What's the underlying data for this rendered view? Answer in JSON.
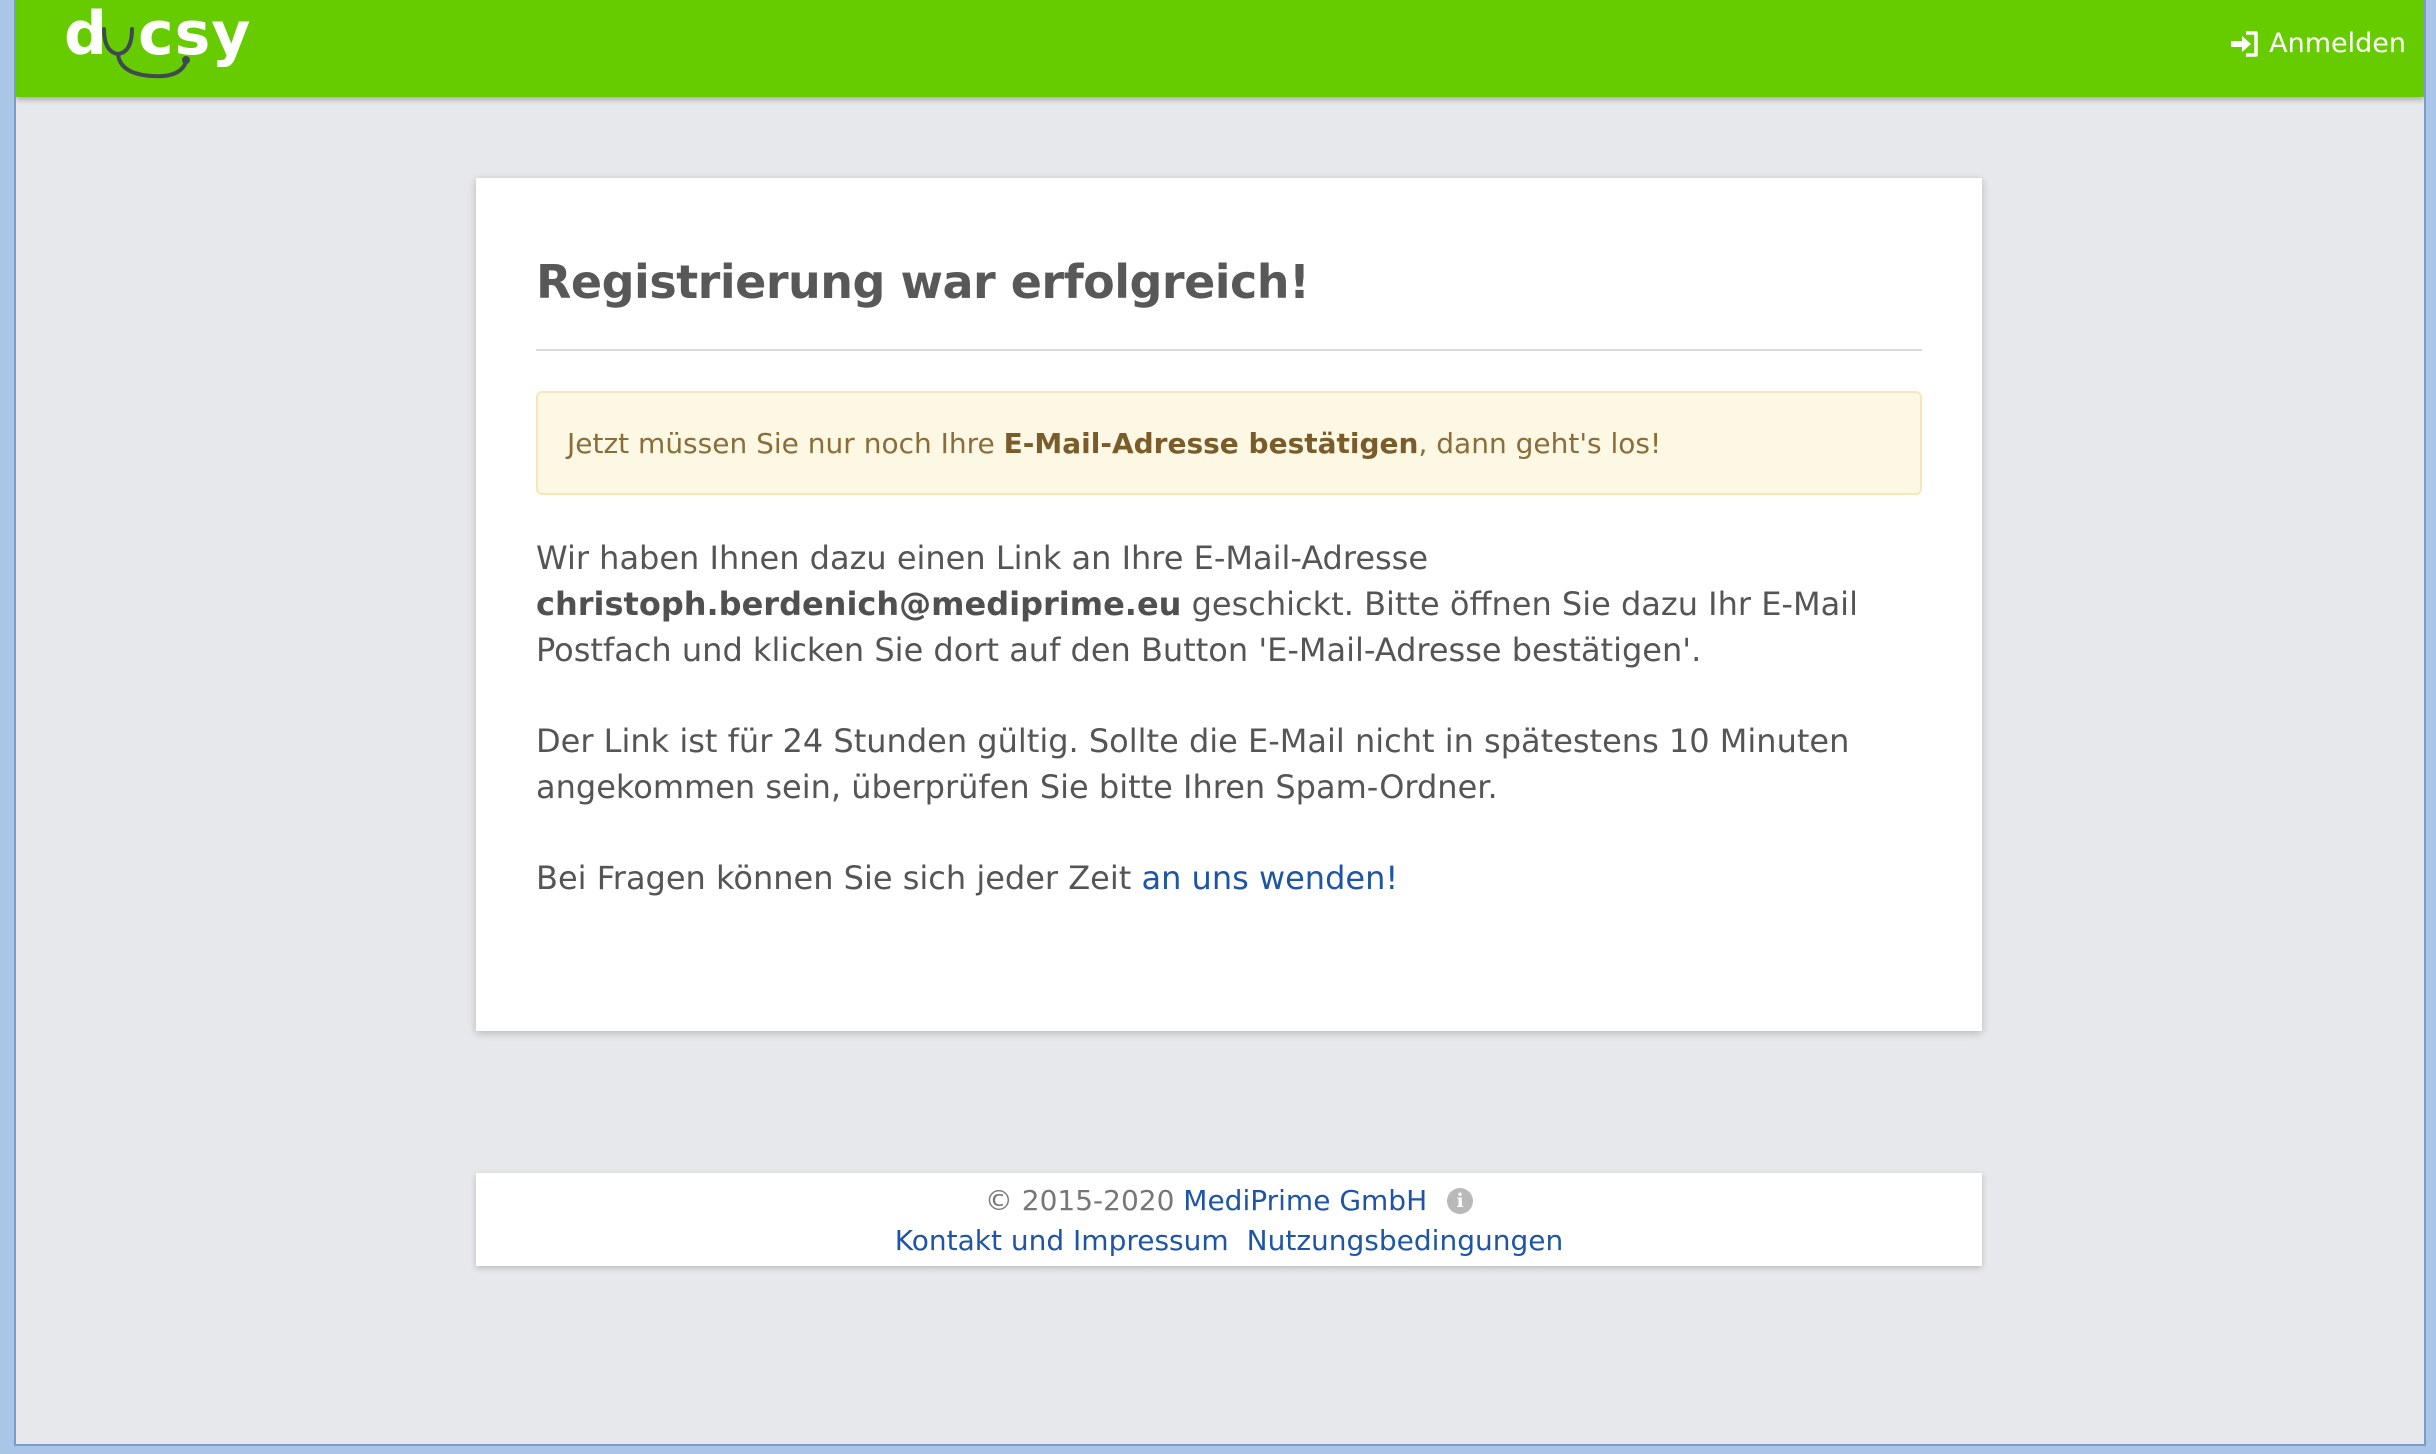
{
  "brand": {
    "logo_text": "docsy",
    "primary_color": "#66cc00",
    "link_color": "#1f55a5"
  },
  "navbar": {
    "login_label": "Anmelden",
    "login_icon": "sign-in-icon"
  },
  "card": {
    "title": "Registrierung war erfolgreich!",
    "alert": {
      "prefix": "Jetzt müssen Sie nur noch Ihre ",
      "bold": "E-Mail-Adresse bestätigen",
      "suffix": ", dann geht's los!"
    },
    "paragraph1": {
      "prefix": "Wir haben Ihnen dazu einen Link an Ihre E-Mail-Adresse ",
      "email": "christoph.berdenich@mediprime.eu",
      "suffix": " geschickt. Bitte öffnen Sie dazu Ihr E-Mail Postfach und klicken Sie dort auf den Button 'E-Mail-Adresse bestätigen'."
    },
    "paragraph2": "Der Link ist für 24 Stunden gültig. Sollte die E-Mail nicht in spätestens 10 Minuten angekommen sein, überprüfen Sie bitte Ihren Spam-Ordner.",
    "paragraph3": {
      "prefix": "Bei Fragen können Sie sich jeder Zeit ",
      "link": "an uns wenden!"
    }
  },
  "footer": {
    "copyright": "© 2015-2020 ",
    "company": "MediPrime GmbH",
    "info_icon_glyph": "i",
    "links": [
      "Kontakt und Impressum",
      "Nutzungsbedingungen"
    ]
  }
}
